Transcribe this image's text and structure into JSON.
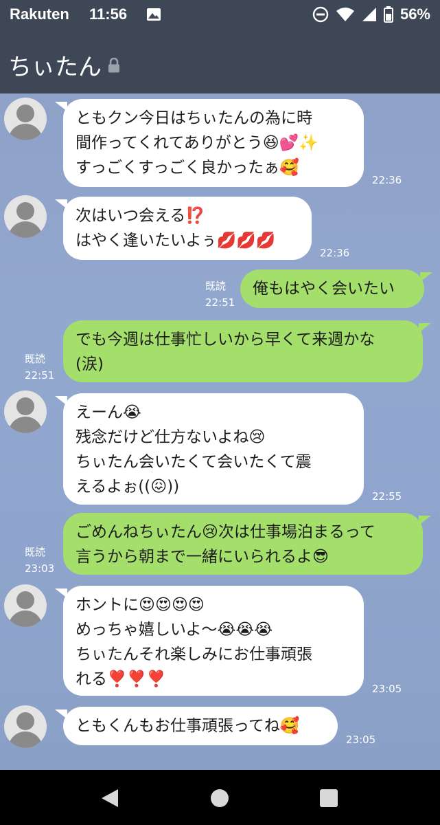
{
  "status_bar": {
    "carrier": "Rakuten",
    "time": "11:56",
    "battery": "56%",
    "icons": [
      "image-icon",
      "dnd-icon",
      "wifi-icon",
      "signal-icon",
      "battery-icon"
    ]
  },
  "header": {
    "title": "ちぃたん",
    "icon": "lock-icon"
  },
  "messages": [
    {
      "direction": "in",
      "lines": [
        "ともクン今日はちぃたんの為に時",
        "間作ってくれてありがとう😆💕✨",
        "すっごくすっごく良かったぁ🥰"
      ],
      "time": "22:36"
    },
    {
      "direction": "in",
      "lines": [
        "次はいつ会える⁉️",
        "はやく逢いたいよぅ💋💋💋"
      ],
      "time": "22:36"
    },
    {
      "direction": "out",
      "lines": [
        "俺もはやく会いたい"
      ],
      "read": "既読",
      "time": "22:51"
    },
    {
      "direction": "out",
      "lines": [
        "でも今週は仕事忙しいから早くて来週かな",
        "(涙)"
      ],
      "read": "既読",
      "time": "22:51"
    },
    {
      "direction": "in",
      "lines": [
        "えーん😭",
        "残念だけど仕方ないよね😢",
        "ちぃたん会いたくて会いたくて震",
        "えるよぉ((😖))"
      ],
      "time": "22:55"
    },
    {
      "direction": "out",
      "lines": [
        "ごめんねちぃたん😢次は仕事場泊まるって",
        "言うから朝まで一緒にいられるよ😎"
      ],
      "read": "既読",
      "time": "23:03"
    },
    {
      "direction": "in",
      "lines": [
        "ホントに😍😍😍😍",
        "めっちゃ嬉しいよ〜😭😭😭",
        "ちぃたんそれ楽しみにお仕事頑張",
        "れる❣️❣️❣️"
      ],
      "time": "23:05"
    },
    {
      "direction": "in",
      "lines": [
        "ともくんもお仕事頑張ってね🥰"
      ],
      "time": "23:05"
    }
  ],
  "nav_bar": {
    "icons": [
      "back-icon",
      "home-icon",
      "recent-apps-icon"
    ]
  }
}
